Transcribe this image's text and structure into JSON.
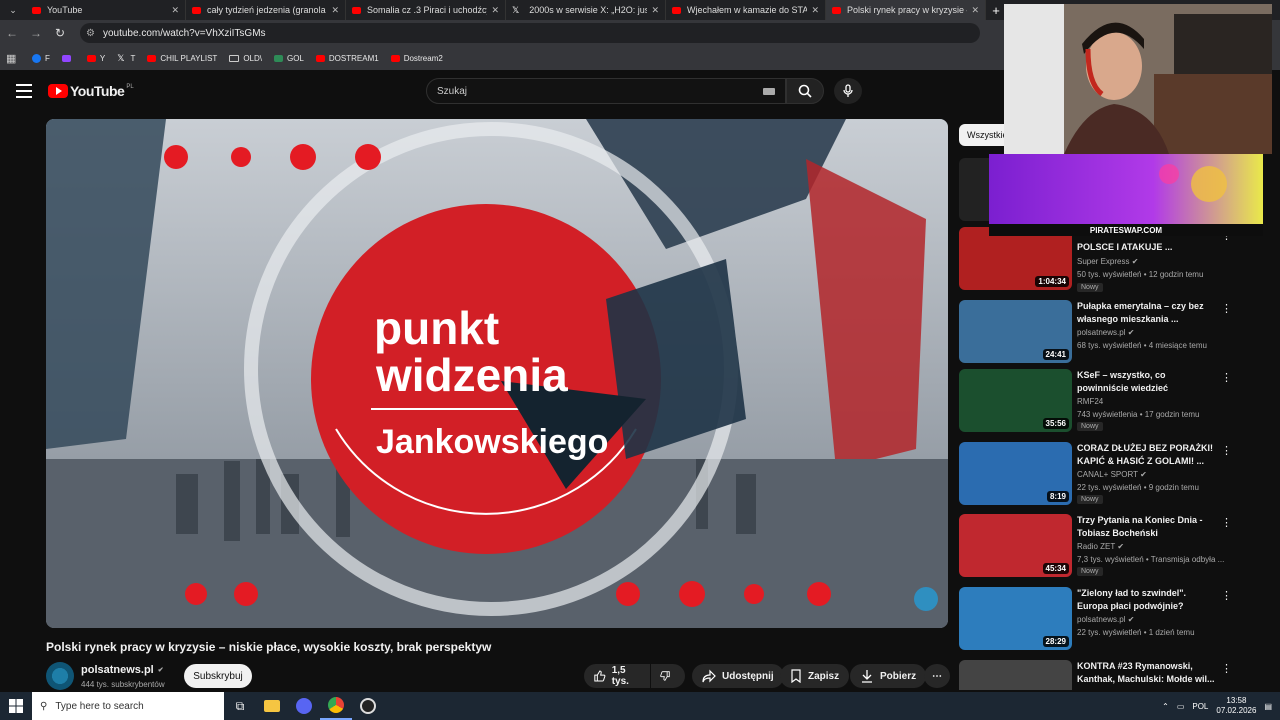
{
  "tabs": [
    {
      "label": "YouTube",
      "icon": "youtube",
      "active": false
    },
    {
      "label": "cały tydzień jedzenia (granola z",
      "icon": "youtube",
      "active": false
    },
    {
      "label": "Somalia cz .3 Piraci i uchodźcy",
      "icon": "youtube",
      "active": false
    },
    {
      "label": "2000s w serwisie X: „H2O: just",
      "icon": "x",
      "active": false
    },
    {
      "label": "Wjechałem w kamazie do STAC",
      "icon": "youtube",
      "active": false
    },
    {
      "label": "Polski rynek pracy w kryzysie –",
      "icon": "youtube",
      "active": true
    }
  ],
  "address": {
    "url": "youtube.com/watch?v=VhXziITsGMs"
  },
  "bookmarks": [
    {
      "label": "F",
      "icon": "facebook"
    },
    {
      "label": "",
      "icon": "twitch"
    },
    {
      "label": "Y",
      "icon": "youtube"
    },
    {
      "label": "T",
      "icon": "x"
    },
    {
      "label": "CHIL PLAYLIST",
      "icon": "youtube"
    },
    {
      "label": "OLD\\",
      "icon": "folder"
    },
    {
      "label": "GOL",
      "icon": "g"
    },
    {
      "label": "DOSTREAM1",
      "icon": "youtube"
    },
    {
      "label": "Dostream2",
      "icon": "youtube"
    }
  ],
  "header": {
    "logo": "YouTube",
    "country": "PL",
    "search_placeholder": "Szukaj"
  },
  "video": {
    "brand_line1": "punkt",
    "brand_line2": "widzenia",
    "brand_line3": "Jankowskiego",
    "title": "Polski rynek pracy w kryzysie – niskie płace, wysokie koszty, brak perspektyw",
    "channel": "polsatnews.pl",
    "subs": "444 tys. subskrybentów",
    "subscribe": "Subskrybuj",
    "likes": "1,5 tys.",
    "share": "Udostępnij",
    "save": "Zapisz",
    "download": "Pobierz"
  },
  "chips": {
    "all": "Wszystkie"
  },
  "overlay": {
    "site": "PIRATESWAP.COM"
  },
  "recommendations": [
    {
      "title": "POLSCE I ATAKUJE ...",
      "channel": "Super Express",
      "meta": "50 tys. wyświetleń • 12 godzin temu",
      "badge": "Nowy",
      "duration": "1:04:34",
      "thumb": "#b02020"
    },
    {
      "title": "Pułapka emerytalna – czy bez własnego mieszkania ...",
      "channel": "polsatnews.pl",
      "meta": "68 tys. wyświetleń • 4 miesiące temu",
      "badge": "",
      "duration": "24:41",
      "thumb": "#3a6e9a"
    },
    {
      "title": "KSeF – wszystko, co powinniście wiedzieć",
      "channel": "RMF24",
      "meta": "743 wyświetlenia • 17 godzin temu",
      "badge": "Nowy",
      "duration": "35:56",
      "thumb": "#1b4f2e"
    },
    {
      "title": "CORAZ DŁUŻEJ BEZ PORAŻKI! KAPIĆ & HASIĆ Z GOLAMI! ...",
      "channel": "CANAL+ SPORT",
      "meta": "22 tys. wyświetleń • 9 godzin temu",
      "badge": "Nowy",
      "duration": "8:19",
      "thumb": "#2b6cb0"
    },
    {
      "title": "Trzy Pytania na Koniec Dnia - Tobiasz Bocheński",
      "channel": "Radio ZET",
      "meta": "7,3 tys. wyświetleń • Transmisja odbyła ...",
      "badge": "Nowy",
      "duration": "45:34",
      "thumb": "#c0282f"
    },
    {
      "title": "\"Zielony ład to szwindel\". Europa płaci podwójnie?",
      "channel": "polsatnews.pl",
      "meta": "22 tys. wyświetleń • 1 dzień temu",
      "badge": "",
      "duration": "28:29",
      "thumb": "#2d7dbd"
    },
    {
      "title": "KONTRA #23 Rymanowski, Kanthak, Machulski: Mołde wil...",
      "channel": "",
      "meta": "",
      "badge": "",
      "duration": "",
      "thumb": "#444"
    }
  ],
  "taskbar": {
    "search_placeholder": "Type here to search",
    "lang": "POL",
    "time": "13:58",
    "date": "07.02.2026"
  }
}
